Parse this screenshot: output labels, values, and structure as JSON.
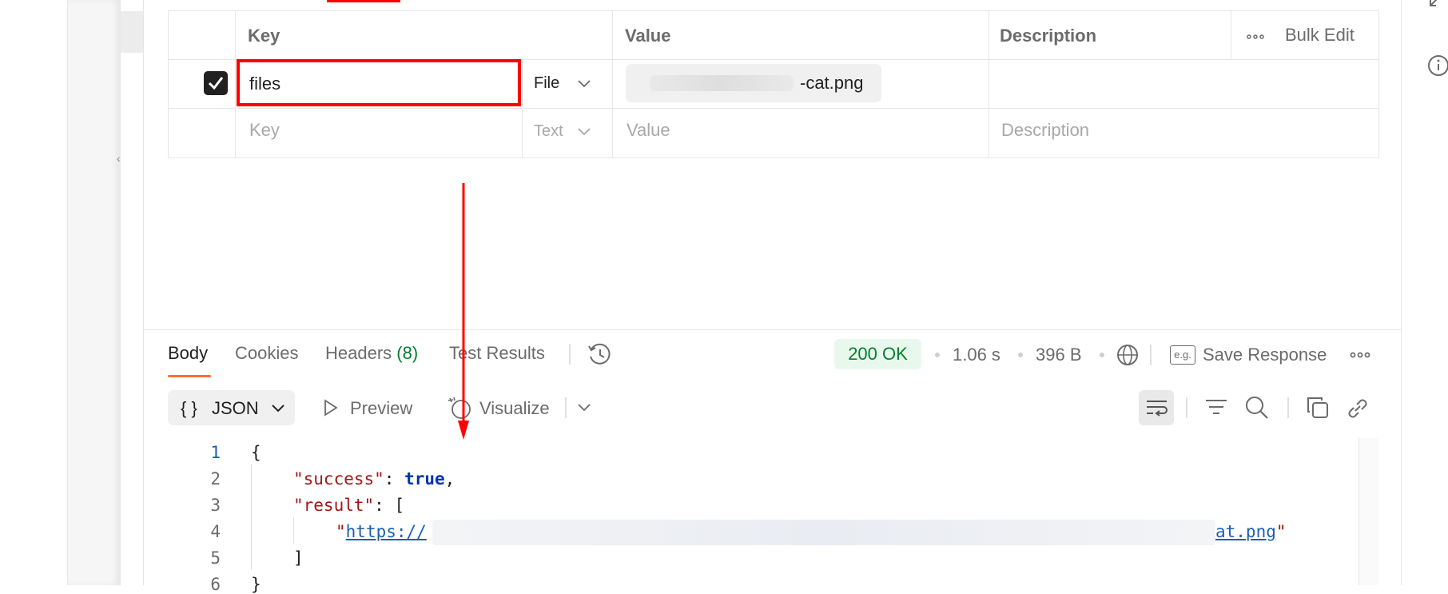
{
  "params_table": {
    "headers": {
      "key": "Key",
      "value": "Value",
      "description": "Description",
      "bulk_edit": "Bulk Edit"
    },
    "rows": [
      {
        "checked": true,
        "key": "files",
        "type": "File",
        "value_file": "-cat.png",
        "description": ""
      }
    ],
    "new_row": {
      "key_placeholder": "Key",
      "type": "Text",
      "value_placeholder": "Value",
      "description_placeholder": "Description"
    }
  },
  "response": {
    "tabs": [
      {
        "label": "Body",
        "active": true
      },
      {
        "label": "Cookies"
      },
      {
        "label": "Headers",
        "count": "(8)"
      },
      {
        "label": "Test Results"
      }
    ],
    "status": "200 OK",
    "time": "1.06 s",
    "size": "396 B",
    "save_response": "Save Response",
    "format": "JSON",
    "preview": "Preview",
    "visualize": "Visualize",
    "eg_badge": "e.g."
  },
  "code": {
    "line_numbers": [
      "1",
      "2",
      "3",
      "4",
      "5",
      "6"
    ],
    "open_brace": "{",
    "success_key": "\"success\"",
    "success_value": "true",
    "result_key": "\"result\"",
    "open_bracket": "[",
    "url_start": "https://",
    "url_end": "at.png",
    "close_bracket": "]",
    "close_brace": "}"
  },
  "colors": {
    "accent": "#ff6c37",
    "status_green": "#007f31",
    "highlight_red": "#ff0000"
  }
}
